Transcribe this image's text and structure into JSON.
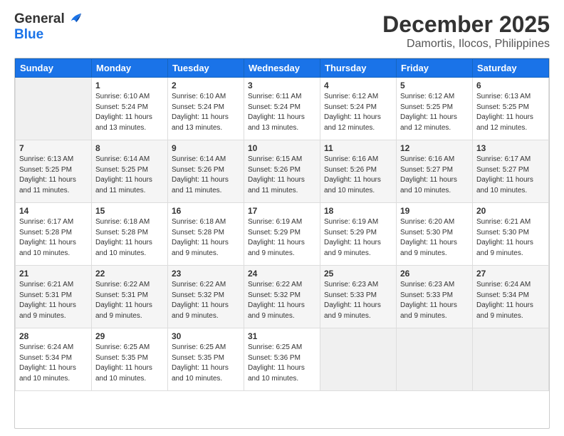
{
  "header": {
    "logo_line1": "General",
    "logo_line2": "Blue",
    "month": "December 2025",
    "location": "Damortis, Ilocos, Philippines"
  },
  "weekdays": [
    "Sunday",
    "Monday",
    "Tuesday",
    "Wednesday",
    "Thursday",
    "Friday",
    "Saturday"
  ],
  "weeks": [
    [
      {
        "day": "",
        "info": ""
      },
      {
        "day": "1",
        "info": "Sunrise: 6:10 AM\nSunset: 5:24 PM\nDaylight: 11 hours\nand 13 minutes."
      },
      {
        "day": "2",
        "info": "Sunrise: 6:10 AM\nSunset: 5:24 PM\nDaylight: 11 hours\nand 13 minutes."
      },
      {
        "day": "3",
        "info": "Sunrise: 6:11 AM\nSunset: 5:24 PM\nDaylight: 11 hours\nand 13 minutes."
      },
      {
        "day": "4",
        "info": "Sunrise: 6:12 AM\nSunset: 5:24 PM\nDaylight: 11 hours\nand 12 minutes."
      },
      {
        "day": "5",
        "info": "Sunrise: 6:12 AM\nSunset: 5:25 PM\nDaylight: 11 hours\nand 12 minutes."
      },
      {
        "day": "6",
        "info": "Sunrise: 6:13 AM\nSunset: 5:25 PM\nDaylight: 11 hours\nand 12 minutes."
      }
    ],
    [
      {
        "day": "7",
        "info": "Sunrise: 6:13 AM\nSunset: 5:25 PM\nDaylight: 11 hours\nand 11 minutes."
      },
      {
        "day": "8",
        "info": "Sunrise: 6:14 AM\nSunset: 5:25 PM\nDaylight: 11 hours\nand 11 minutes."
      },
      {
        "day": "9",
        "info": "Sunrise: 6:14 AM\nSunset: 5:26 PM\nDaylight: 11 hours\nand 11 minutes."
      },
      {
        "day": "10",
        "info": "Sunrise: 6:15 AM\nSunset: 5:26 PM\nDaylight: 11 hours\nand 11 minutes."
      },
      {
        "day": "11",
        "info": "Sunrise: 6:16 AM\nSunset: 5:26 PM\nDaylight: 11 hours\nand 10 minutes."
      },
      {
        "day": "12",
        "info": "Sunrise: 6:16 AM\nSunset: 5:27 PM\nDaylight: 11 hours\nand 10 minutes."
      },
      {
        "day": "13",
        "info": "Sunrise: 6:17 AM\nSunset: 5:27 PM\nDaylight: 11 hours\nand 10 minutes."
      }
    ],
    [
      {
        "day": "14",
        "info": "Sunrise: 6:17 AM\nSunset: 5:28 PM\nDaylight: 11 hours\nand 10 minutes."
      },
      {
        "day": "15",
        "info": "Sunrise: 6:18 AM\nSunset: 5:28 PM\nDaylight: 11 hours\nand 10 minutes."
      },
      {
        "day": "16",
        "info": "Sunrise: 6:18 AM\nSunset: 5:28 PM\nDaylight: 11 hours\nand 9 minutes."
      },
      {
        "day": "17",
        "info": "Sunrise: 6:19 AM\nSunset: 5:29 PM\nDaylight: 11 hours\nand 9 minutes."
      },
      {
        "day": "18",
        "info": "Sunrise: 6:19 AM\nSunset: 5:29 PM\nDaylight: 11 hours\nand 9 minutes."
      },
      {
        "day": "19",
        "info": "Sunrise: 6:20 AM\nSunset: 5:30 PM\nDaylight: 11 hours\nand 9 minutes."
      },
      {
        "day": "20",
        "info": "Sunrise: 6:21 AM\nSunset: 5:30 PM\nDaylight: 11 hours\nand 9 minutes."
      }
    ],
    [
      {
        "day": "21",
        "info": "Sunrise: 6:21 AM\nSunset: 5:31 PM\nDaylight: 11 hours\nand 9 minutes."
      },
      {
        "day": "22",
        "info": "Sunrise: 6:22 AM\nSunset: 5:31 PM\nDaylight: 11 hours\nand 9 minutes."
      },
      {
        "day": "23",
        "info": "Sunrise: 6:22 AM\nSunset: 5:32 PM\nDaylight: 11 hours\nand 9 minutes."
      },
      {
        "day": "24",
        "info": "Sunrise: 6:22 AM\nSunset: 5:32 PM\nDaylight: 11 hours\nand 9 minutes."
      },
      {
        "day": "25",
        "info": "Sunrise: 6:23 AM\nSunset: 5:33 PM\nDaylight: 11 hours\nand 9 minutes."
      },
      {
        "day": "26",
        "info": "Sunrise: 6:23 AM\nSunset: 5:33 PM\nDaylight: 11 hours\nand 9 minutes."
      },
      {
        "day": "27",
        "info": "Sunrise: 6:24 AM\nSunset: 5:34 PM\nDaylight: 11 hours\nand 9 minutes."
      }
    ],
    [
      {
        "day": "28",
        "info": "Sunrise: 6:24 AM\nSunset: 5:34 PM\nDaylight: 11 hours\nand 10 minutes."
      },
      {
        "day": "29",
        "info": "Sunrise: 6:25 AM\nSunset: 5:35 PM\nDaylight: 11 hours\nand 10 minutes."
      },
      {
        "day": "30",
        "info": "Sunrise: 6:25 AM\nSunset: 5:35 PM\nDaylight: 11 hours\nand 10 minutes."
      },
      {
        "day": "31",
        "info": "Sunrise: 6:25 AM\nSunset: 5:36 PM\nDaylight: 11 hours\nand 10 minutes."
      },
      {
        "day": "",
        "info": ""
      },
      {
        "day": "",
        "info": ""
      },
      {
        "day": "",
        "info": ""
      }
    ]
  ]
}
